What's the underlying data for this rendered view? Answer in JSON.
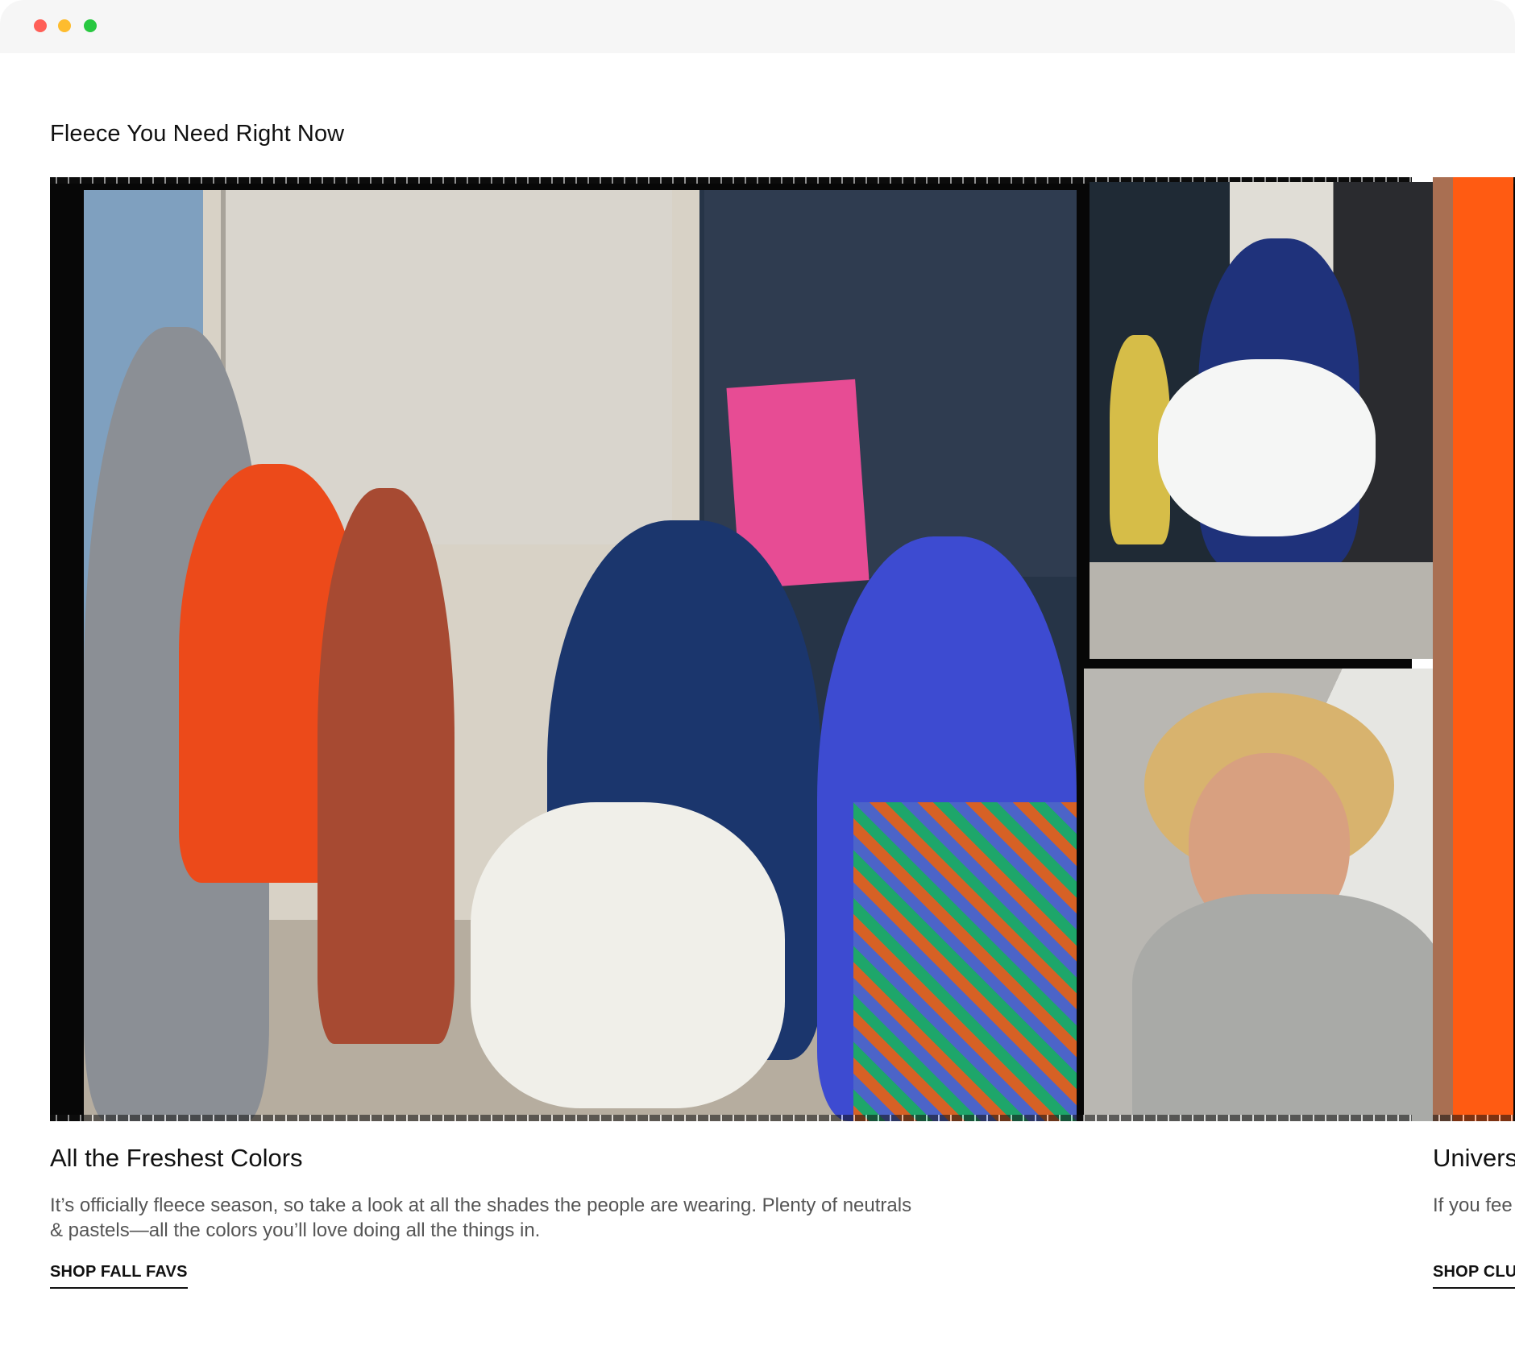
{
  "window": {
    "controls": [
      "close",
      "minimize",
      "zoom"
    ]
  },
  "section": {
    "title": "Fleece You Need Right Now"
  },
  "cards": [
    {
      "title": "All the Freshest Colors",
      "description": "It’s officially fleece season, so take a look at all the shades the people are wearing. Plenty of neutrals & pastels—all the colors you’ll love doing all the things in.",
      "link": "SHOP FALL FAVS"
    },
    {
      "title": "Univers",
      "description": "If you fee Club Fle",
      "link": "SHOP CLU"
    }
  ],
  "colors": {
    "text": "#111111",
    "secondary_text": "#555555",
    "traffic_red": "#ff5f57",
    "traffic_yellow": "#febc2e",
    "traffic_green": "#28c840"
  }
}
